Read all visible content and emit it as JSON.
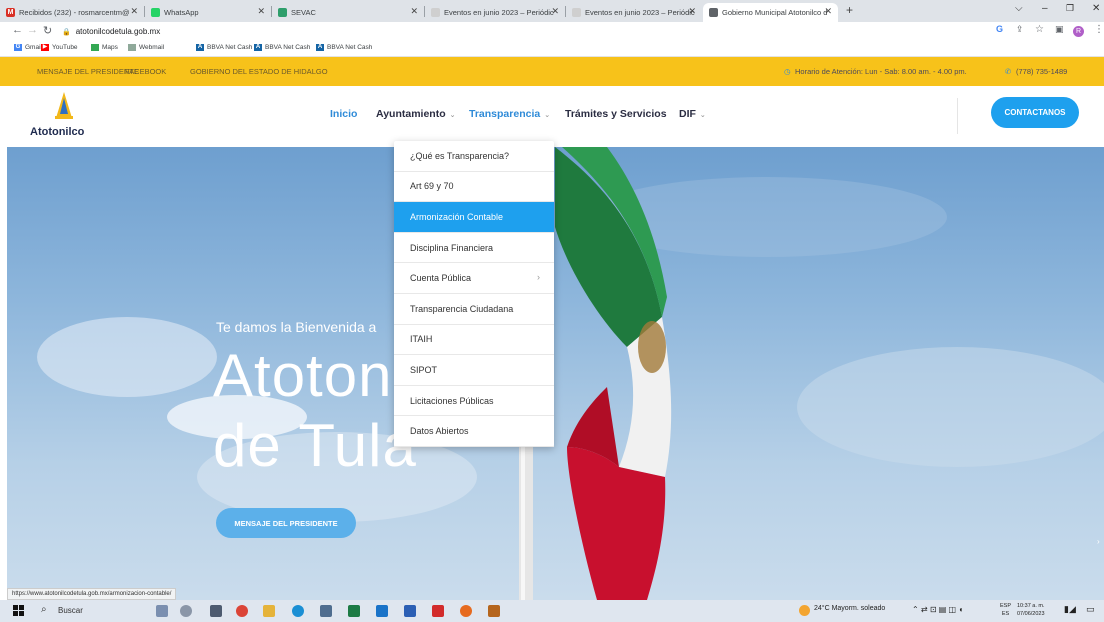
{
  "browser": {
    "tabs": [
      {
        "label": "Recibidos (232) - rosmarcentm@",
        "icon": "gmail-icon",
        "color": "#d93025",
        "glyph": "M",
        "active": false
      },
      {
        "label": "WhatsApp",
        "icon": "whatsapp-icon",
        "color": "#25d366",
        "glyph": "",
        "active": false
      },
      {
        "label": "SEVAC",
        "icon": "sevac-icon",
        "color": "#2e9e6b",
        "glyph": "",
        "active": false
      },
      {
        "label": "Eventos en junio 2023 – Periódic",
        "icon": "page-icon",
        "color": "#cfcfcf",
        "glyph": "",
        "active": false
      },
      {
        "label": "Eventos en junio 2023 – Periódic",
        "icon": "page-icon",
        "color": "#cfcfcf",
        "glyph": "",
        "active": false
      },
      {
        "label": "Gobierno Municipal Atotonilco d",
        "icon": "globe-icon",
        "color": "#5f6368",
        "glyph": "",
        "active": true
      }
    ],
    "new_tab": "+",
    "url": "atotonilcodetula.gob.mx",
    "bookmarks": [
      {
        "label": "Gmail",
        "icon": "google-icon",
        "color": "#4285f4",
        "glyph": "G"
      },
      {
        "label": "YouTube",
        "icon": "youtube-icon",
        "color": "#ff0000",
        "glyph": "▶"
      },
      {
        "label": "Maps",
        "icon": "maps-icon",
        "color": "#34a853",
        "glyph": ""
      },
      {
        "label": "Webmail",
        "icon": "webmail-icon",
        "color": "#8fa99a",
        "glyph": ""
      },
      {
        "label": "BBVA Net Cash",
        "icon": "bbva-icon",
        "color": "#1464a5",
        "glyph": "A"
      },
      {
        "label": "BBVA Net Cash",
        "icon": "bbva-icon",
        "color": "#1464a5",
        "glyph": "A"
      },
      {
        "label": "BBVA Net Cash",
        "icon": "bbva-icon",
        "color": "#1464a5",
        "glyph": "A"
      }
    ],
    "profile_initial": "R",
    "status_url": "https://www.atotonilcodetula.gob.mx/armonizacion-contable/"
  },
  "site": {
    "topbar": {
      "links": [
        "MENSAJE DEL PRESIDENTE",
        "FACEBOOK",
        "GOBIERNO DEL ESTADO DE HIDALGO"
      ],
      "hours": "Horario de Atención: Lun - Sab: 8.00 am. - 4.00 pm.",
      "phone": "(778) 735-1489"
    },
    "logo_text": "Atotonilco",
    "nav": [
      {
        "label": "Inicio",
        "caret": false,
        "highlight": true
      },
      {
        "label": "Ayuntamiento",
        "caret": true,
        "highlight": false
      },
      {
        "label": "Transparencia",
        "caret": true,
        "highlight": true
      },
      {
        "label": "Trámites y Servicios",
        "caret": false,
        "highlight": false
      },
      {
        "label": "DIF",
        "caret": true,
        "highlight": false
      }
    ],
    "contact_button": "CONTACTANOS",
    "dropdown": [
      {
        "label": "¿Qué es Transparencia?",
        "active": false,
        "submenu": false
      },
      {
        "label": "Art 69 y 70",
        "active": false,
        "submenu": false
      },
      {
        "label": "Armonización Contable",
        "active": true,
        "submenu": false
      },
      {
        "label": "Disciplina Financiera",
        "active": false,
        "submenu": false
      },
      {
        "label": "Cuenta Pública",
        "active": false,
        "submenu": true
      },
      {
        "label": "Transparencia Ciudadana",
        "active": false,
        "submenu": false
      },
      {
        "label": "ITAIH",
        "active": false,
        "submenu": false
      },
      {
        "label": "SIPOT",
        "active": false,
        "submenu": false
      },
      {
        "label": "Licitaciones Públicas",
        "active": false,
        "submenu": false
      },
      {
        "label": "Datos Abiertos",
        "active": false,
        "submenu": false
      }
    ],
    "hero": {
      "welcome": "Te damos la Bienvenida a",
      "title_line1": "Atotonilco",
      "title_line2": "de Tula",
      "button": "MENSAJE DEL PRESIDENTE"
    }
  },
  "taskbar": {
    "search": "Buscar",
    "weather": "24°C Mayorm. soleado",
    "lang": "ESP",
    "lang_sub": "ES",
    "time": "10:37 a. m.",
    "date": "07/06/2023"
  },
  "colors": {
    "accent": "#1ea0ee",
    "topbar": "#f7c21a",
    "nav_highlight": "#2f8bd8"
  }
}
